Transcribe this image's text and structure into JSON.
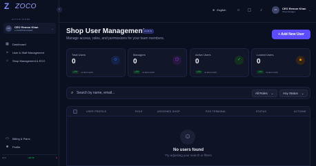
{
  "app": {
    "logo_text": "ZOCO"
  },
  "sidebar": {
    "store_label": "ACTIVE STORE",
    "user": {
      "initials": "CR",
      "name": "CEO Remon Khan",
      "status": "SHOPMANAGER"
    },
    "nav": [
      {
        "label": "Dashboard",
        "icon": "dashboard-icon"
      },
      {
        "label": "User & Staff Management",
        "icon": "users-icon"
      },
      {
        "label": "Shop Management & ECO",
        "icon": "shop-icon"
      }
    ],
    "bottom_nav": [
      {
        "label": "Billing & Plans",
        "icon": "card-icon"
      },
      {
        "label": "Profile",
        "icon": "user-icon"
      }
    ],
    "footer": {
      "left": "v1.0",
      "middle": "+16.3K"
    }
  },
  "topbar": {
    "language": "English",
    "user": {
      "initials": "CR",
      "name": "CEO Remon Khan",
      "role": "Shopmanager"
    }
  },
  "page": {
    "title": "Shop User Management",
    "badge": "ADMIN",
    "subtitle": "Manage access, roles, and permissions for your team members.",
    "add_button": "+ Add New User"
  },
  "stats": [
    {
      "label": "Total Users",
      "value": "0",
      "change": "+0%",
      "change_note": "vs last month",
      "icon": "users-icon",
      "color": "#3b82f6"
    },
    {
      "label": "Managers",
      "value": "0",
      "change": "+0%",
      "change_note": "vs last month",
      "icon": "shield-icon",
      "color": "#a855f7"
    },
    {
      "label": "Active Users",
      "value": "0",
      "change": "+0%",
      "change_note": "vs last month",
      "icon": "check-circle-icon",
      "color": "#22c55e"
    },
    {
      "label": "Locked Users",
      "value": "0",
      "change": "+0%",
      "change_note": "vs last month",
      "icon": "lock-icon",
      "color": "#f59e0b"
    }
  ],
  "filters": {
    "search_placeholder": "Search by name, email...",
    "roles_select": "All Roles",
    "status_select": "Any Status"
  },
  "table": {
    "headers": [
      "USER PROFILE",
      "ROLE",
      "ASSIGNED SHOP",
      "POS TERMINAL",
      "STATUS",
      "ACTIONS"
    ],
    "empty_title": "No users found",
    "empty_subtitle": "Try adjusting your search or filters"
  }
}
